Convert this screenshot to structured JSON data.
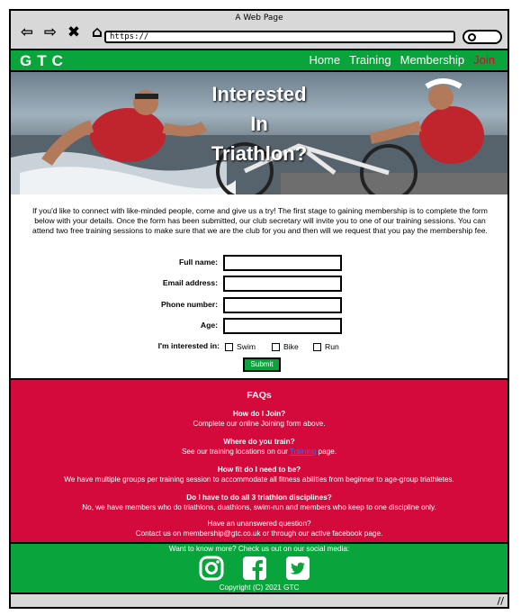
{
  "window": {
    "title": "A Web Page",
    "url": "https://"
  },
  "header": {
    "logo": "GTC",
    "nav": [
      {
        "label": "Home"
      },
      {
        "label": "Training"
      },
      {
        "label": "Membership"
      },
      {
        "label": "Join",
        "active": true
      }
    ],
    "active_color": "#d40a2e",
    "brand_color": "#0aa43c"
  },
  "hero": {
    "title_line1": "Interested",
    "title_line2": "In",
    "title_line3": "Triathlon?"
  },
  "intro": "If you'd like to connect with like-minded people, come and give us a try! The first stage to gaining membership is to complete the form below with your details. Once the form has been submitted, our club secretary will invite you to one of our training sessions. You can attend two free training sessions to make sure that we are the club for you and then will we request that you pay the membership fee.",
  "form": {
    "full_name_label": "Full name:",
    "email_label": "Email address:",
    "phone_label": "Phone number:",
    "age_label": "Age:",
    "interest_label": "I'm interested in:",
    "options": [
      "Swim",
      "Bike",
      "Run"
    ],
    "submit_label": "Submit"
  },
  "faq": {
    "title": "FAQs",
    "items": [
      {
        "q": "How do I Join?",
        "a": "Complete our online Joining form above."
      },
      {
        "q": "Where do you train?",
        "a_before": "See our training locations on our ",
        "a_link": "Training",
        "a_after": " page."
      },
      {
        "q": "How fit do I need to be?",
        "a": "We have multiple groups per training session to accommodate all fitness abilities from beginner to age-group triathletes."
      },
      {
        "q": "Do I have to do all 3 triathlon disciplines?",
        "a": "No, we have members who do triathlons, duathlons, swim-run and members who keep to one discipline only."
      }
    ],
    "closing_line1": "Have an unanswered question?",
    "closing_line2": "Contact us on membership@gtc.co.uk or through our active facebook page.",
    "background_color": "#d40a3c"
  },
  "footer": {
    "social_text": "Want to know more? Check us out on our social media:",
    "socials": [
      "instagram-icon",
      "facebook-icon",
      "twitter-icon"
    ],
    "copyright": "Copyright (C) 2021 GTC"
  }
}
